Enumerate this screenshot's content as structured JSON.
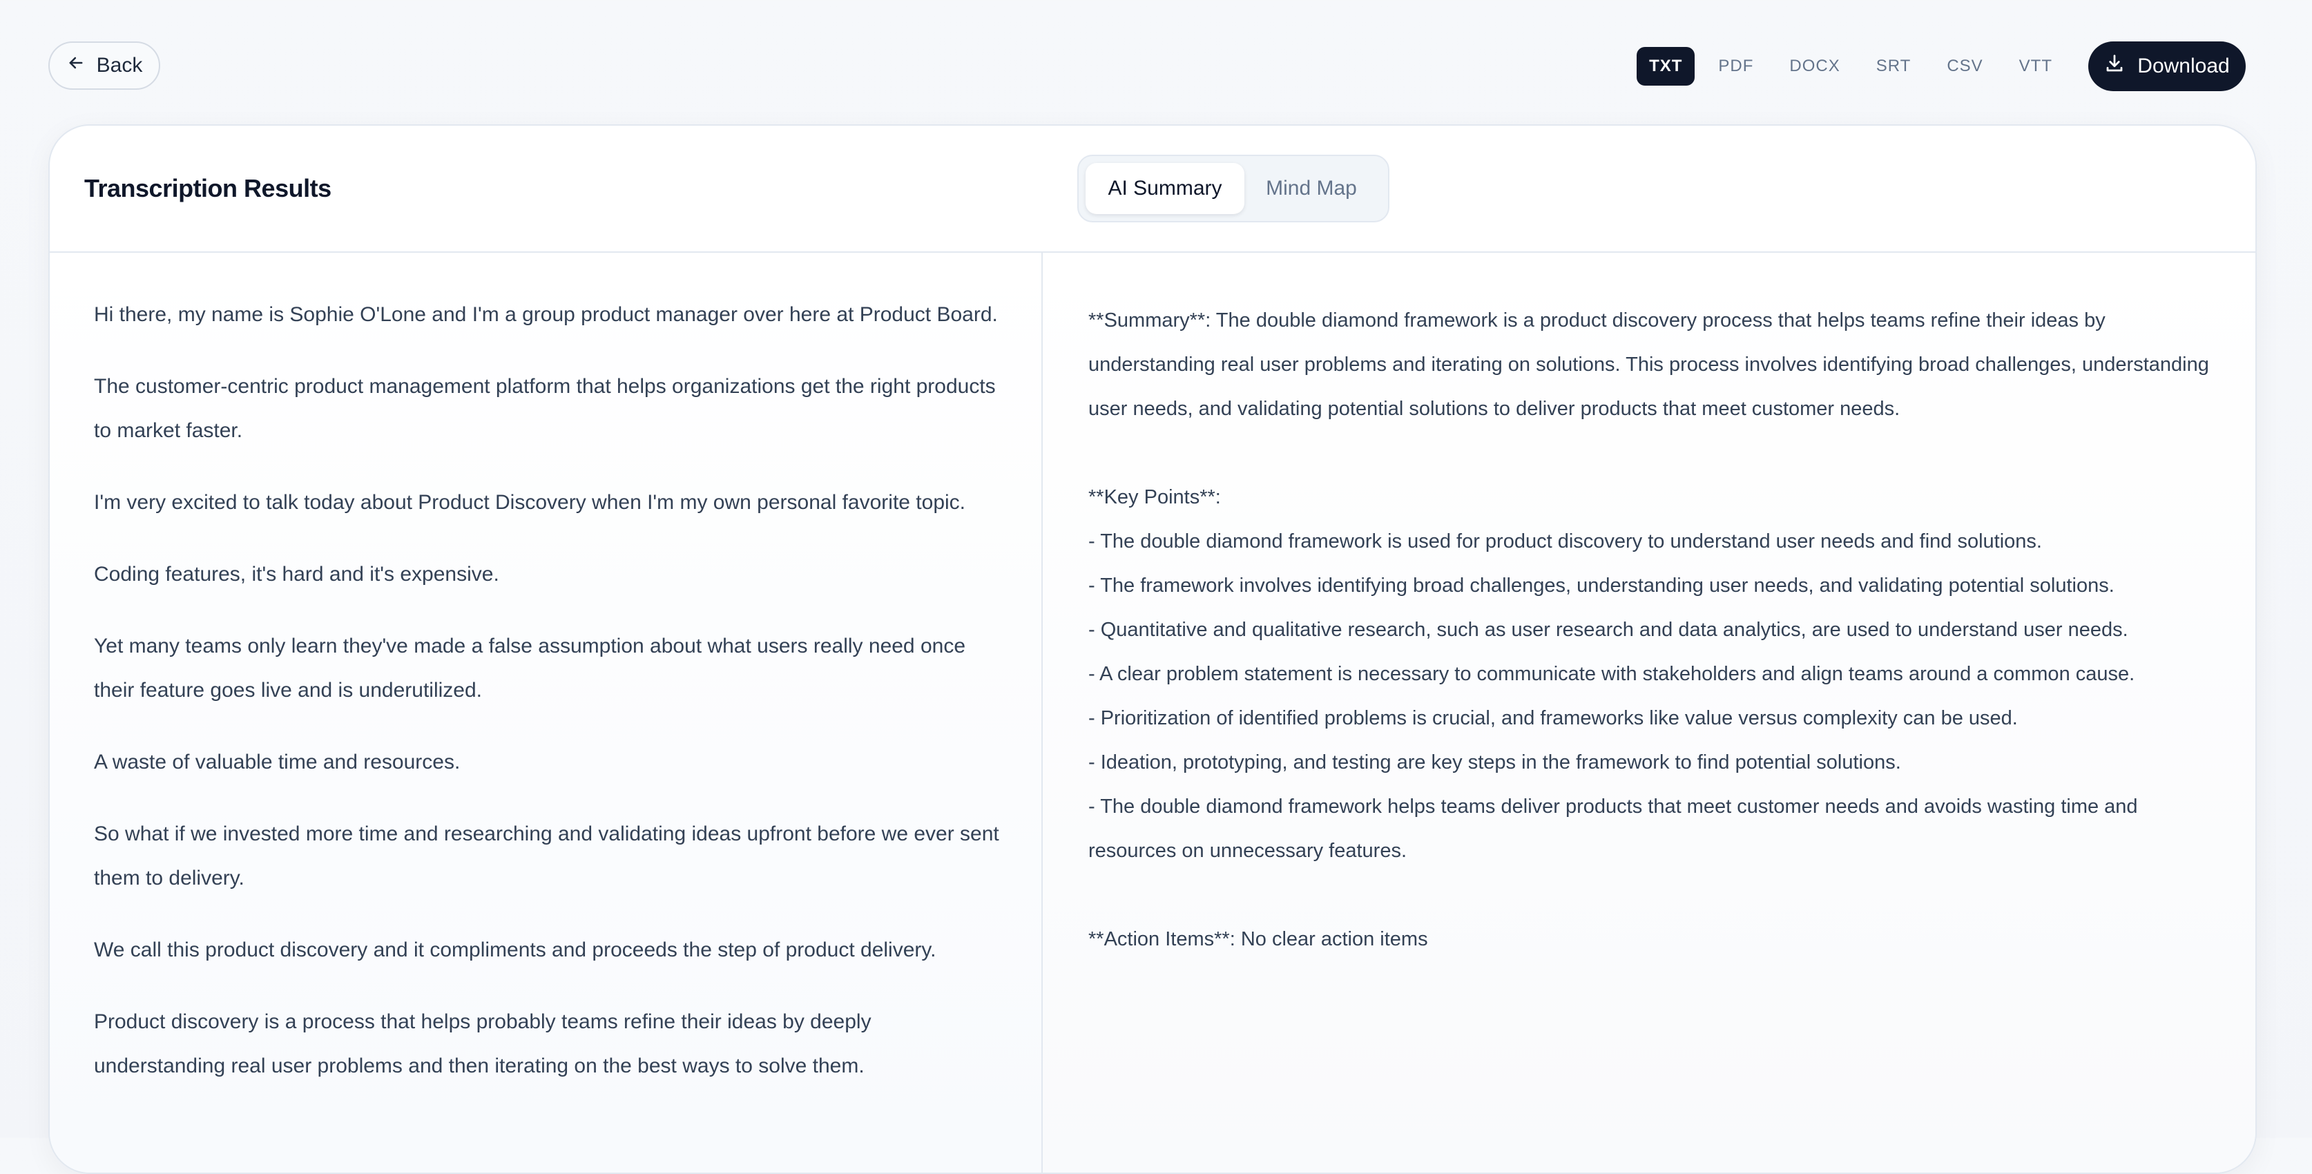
{
  "toolbar": {
    "back_label": "Back",
    "formats": [
      "TXT",
      "PDF",
      "DOCX",
      "SRT",
      "CSV",
      "VTT"
    ],
    "active_format": "TXT",
    "download_label": "Download"
  },
  "card": {
    "title": "Transcription Results",
    "tabs": [
      "AI Summary",
      "Mind Map"
    ],
    "active_tab": "AI Summary"
  },
  "transcript": [
    "Hi there, my name is Sophie O'Lone and I'm a group product manager over here at Product Board.",
    "The customer-centric product management platform that helps organizations get the right products to market faster.",
    "I'm very excited to talk today about Product Discovery when I'm my own personal favorite topic.",
    "Coding features, it's hard and it's expensive.",
    "Yet many teams only learn they've made a false assumption about what users really need once their feature goes live and is underutilized.",
    "A waste of valuable time and resources.",
    "So what if we invested more time and researching and validating ideas upfront before we ever sent them to delivery.",
    "We call this product discovery and it compliments and proceeds the step of product delivery.",
    "Product discovery is a process that helps probably teams refine their ideas by deeply understanding real user problems and then iterating on the best ways to solve them."
  ],
  "summary": "**Summary**: The double diamond framework is a product discovery process that helps teams refine their ideas by understanding real user problems and iterating on solutions. This process involves identifying broad challenges, understanding user needs, and validating potential solutions to deliver products that meet customer needs.\n\n**Key Points**:\n- The double diamond framework is used for product discovery to understand user needs and find solutions.\n- The framework involves identifying broad challenges, understanding user needs, and validating potential solutions.\n- Quantitative and qualitative research, such as user research and data analytics, are used to understand user needs.\n- A clear problem statement is necessary to communicate with stakeholders and align teams around a common cause.\n- Prioritization of identified problems is crucial, and frameworks like value versus complexity can be used.\n- Ideation, prototyping, and testing are key steps in the framework to find potential solutions.\n- The double diamond framework helps teams deliver products that meet customer needs and avoids wasting time and resources on unnecessary features.\n\n**Action Items**: No clear action items"
}
